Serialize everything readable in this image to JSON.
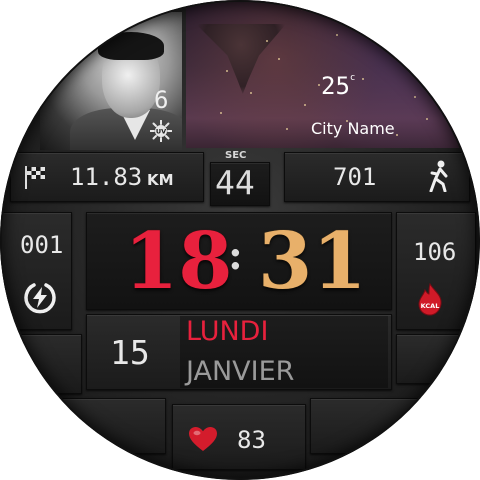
{
  "uv": {
    "value": "6",
    "icon": "uv-index-icon"
  },
  "weather": {
    "temperature": "25",
    "unit": "c",
    "city": "City Name",
    "icon": "tornado-image"
  },
  "distance": {
    "value": "11.83",
    "unit": "KM",
    "icon": "checkered-flag-icon"
  },
  "seconds": {
    "label": "SEC",
    "value": "44"
  },
  "steps": {
    "value": "701",
    "icon": "walking-person-icon"
  },
  "battery": {
    "value": "001",
    "icon": "charging-bolt-icon"
  },
  "time": {
    "hours": "18",
    "separator": ":",
    "minutes": "31"
  },
  "calories": {
    "value": "106",
    "badge": "KCAL",
    "icon": "calorie-flame-icon"
  },
  "date": {
    "day_number": "15",
    "weekday": "LUNDI",
    "month": "JANVIER"
  },
  "bluetooth": {
    "icon": "bluetooth-icon"
  },
  "heart_rate": {
    "value": "83",
    "icon": "heart-icon"
  },
  "colors": {
    "accent_red": "#e8213d",
    "accent_gold": "#e8b06a",
    "text": "#e8e8e8"
  }
}
